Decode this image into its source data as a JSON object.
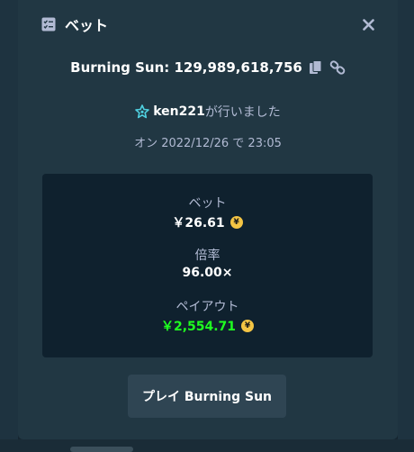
{
  "modal": {
    "title": "ベット",
    "game_line": "Burning Sun: 129,989,618,756",
    "user_name": "ken221",
    "user_suffix": "が行いました",
    "date_line": "オン 2022/12/26 で 23:05"
  },
  "stats": {
    "bet_label": "ベット",
    "bet_value": "￥26.61",
    "multiplier_label": "倍率",
    "multiplier_value": "96.00×",
    "payout_label": "ペイアウト",
    "payout_value": "￥2,554.71"
  },
  "currency_symbol": "¥",
  "play_button": "プレイ Burning Sun",
  "colors": {
    "accent_green": "#1fff20",
    "coin": "#f4c544",
    "modal_bg": "#213743",
    "stats_bg": "#0f212e"
  },
  "icons": [
    "bet-list-icon",
    "close-icon",
    "copy-icon",
    "link-icon",
    "vip-star-icon",
    "yen-coin-icon"
  ]
}
